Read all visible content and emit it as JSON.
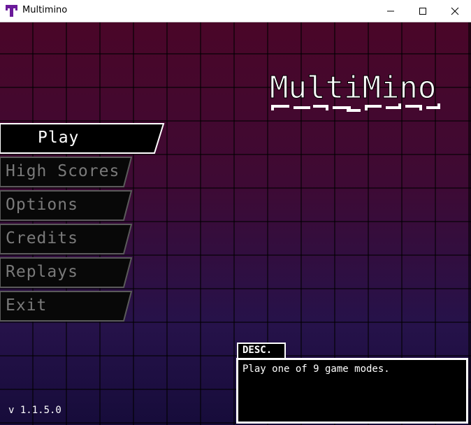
{
  "window": {
    "title": "Multimino",
    "controls": {
      "minimize": "minimize-icon",
      "maximize": "maximize-icon",
      "close": "close-icon"
    }
  },
  "logo": {
    "text": "MultiMino"
  },
  "menu": {
    "items": [
      {
        "label": "Play",
        "state": "selected"
      },
      {
        "label": "High Scores",
        "state": "normal"
      },
      {
        "label": "Options",
        "state": "normal"
      },
      {
        "label": "Credits",
        "state": "normal"
      },
      {
        "label": "Replays",
        "state": "normal"
      },
      {
        "label": "Exit",
        "state": "normal"
      }
    ]
  },
  "description": {
    "tab_label": "DESC.",
    "text": "Play one of 9 game modes."
  },
  "version": "v 1.1.5.0",
  "colors": {
    "background_top": "#4a0628",
    "background_bottom": "#160c3a",
    "app_icon": "#6a1a9a",
    "selected_text": "#ffffff",
    "unselected_text": "#7a7a7a"
  }
}
